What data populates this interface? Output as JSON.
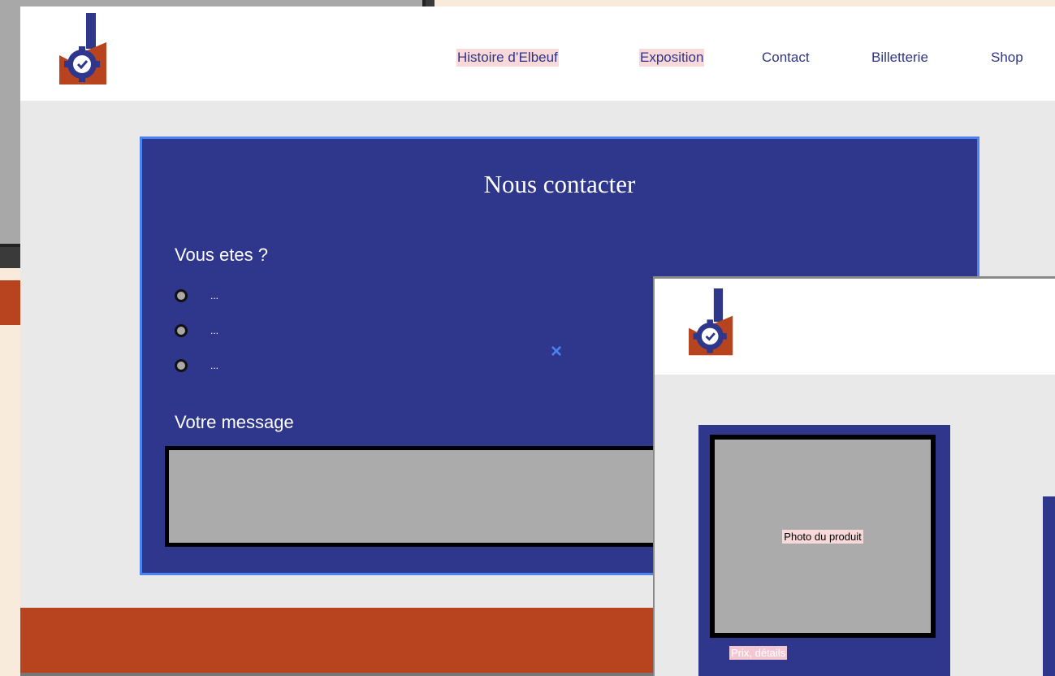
{
  "main_window": {
    "nav": {
      "items": [
        {
          "label": "Histoire d’Elbeuf",
          "highlighted": true
        },
        {
          "label": "Exposition",
          "highlighted": true
        },
        {
          "label": "Contact",
          "highlighted": false
        },
        {
          "label": "Billetterie",
          "highlighted": false
        },
        {
          "label": "Shop",
          "highlighted": false
        }
      ]
    },
    "contact": {
      "title": "Nous contacter",
      "question_label": "Vous etes ?",
      "options": [
        "...",
        "...",
        "..."
      ],
      "close_symbol": "×",
      "message_label": "Votre message",
      "message_value": ""
    }
  },
  "shop_window": {
    "product": {
      "photo_label": "Photo du produit",
      "price_label": "Prix, détails"
    }
  },
  "colors": {
    "brand_blue": "#2e378c",
    "accent_orange": "#b8441f",
    "accent_link_blue": "#4a82f0",
    "highlight_pink": "#f7d9d9",
    "cream": "#f8ebdc"
  },
  "icons": [
    "factory-clock-logo",
    "close-icon",
    "radio-button"
  ]
}
